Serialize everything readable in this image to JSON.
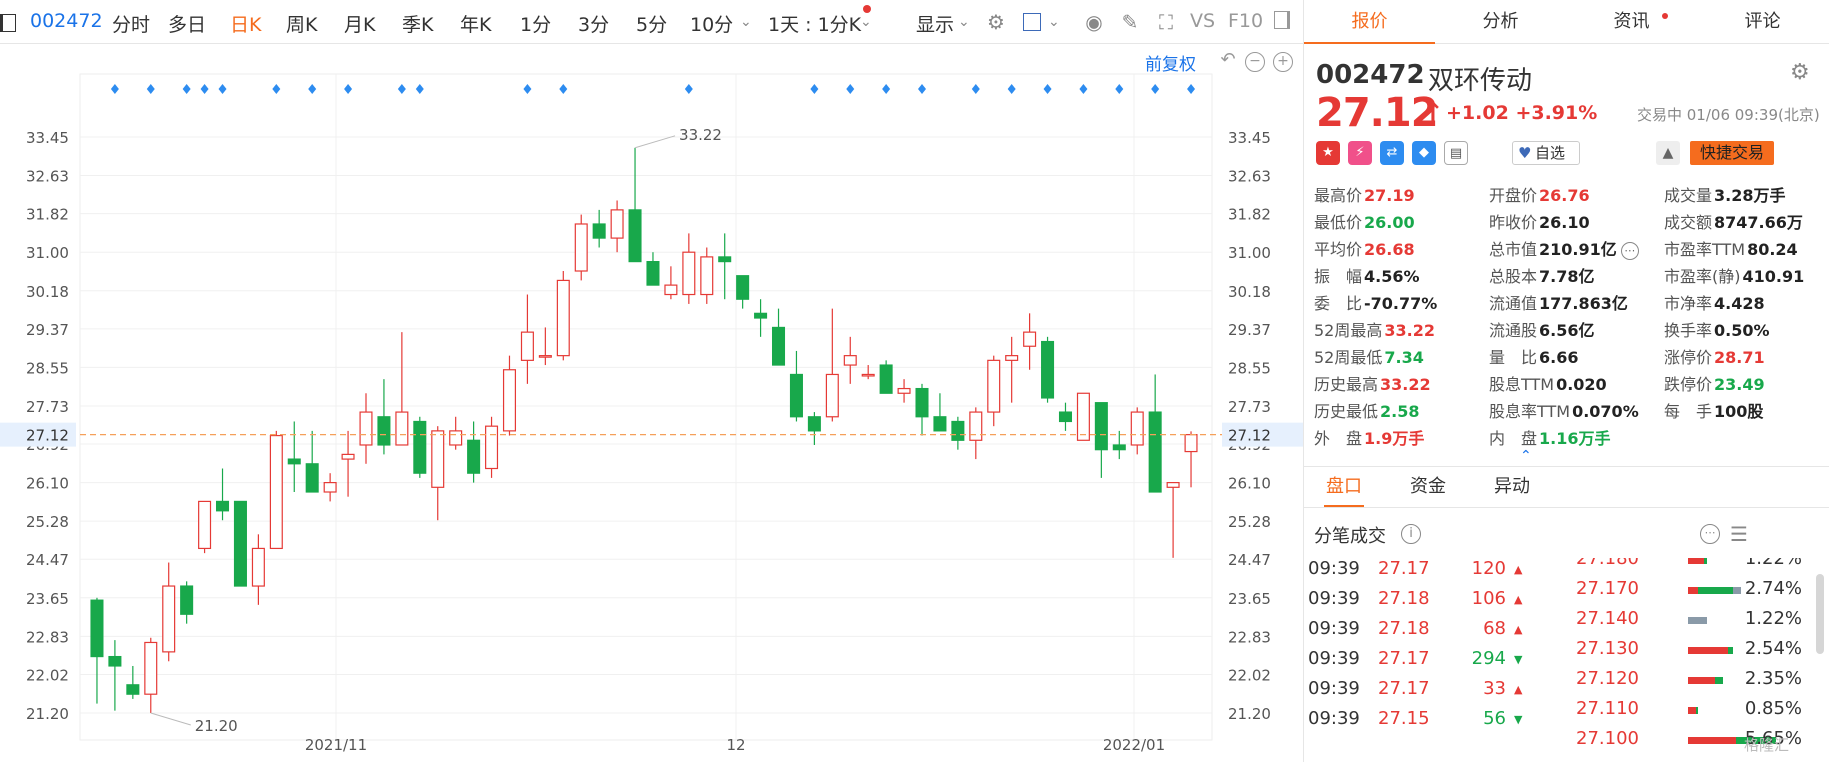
{
  "toolbar": {
    "code": "002472",
    "items": [
      "分时",
      "多日",
      "日K",
      "周K",
      "月K",
      "季K",
      "年K",
      "1分",
      "3分",
      "5分",
      "10分"
    ],
    "active": "日K",
    "period_select": "1天 : 1分K",
    "display_label": "显示",
    "vs_label": "VS",
    "f10_label": "F10"
  },
  "chart_controls": {
    "restore_label": "前复权"
  },
  "chart_data": {
    "type": "candlestick",
    "y_ticks": [
      "33.45",
      "32.63",
      "31.82",
      "31.00",
      "30.18",
      "29.37",
      "28.55",
      "27.73",
      "26.92",
      "26.10",
      "25.28",
      "24.47",
      "23.65",
      "22.83",
      "22.02",
      "21.20"
    ],
    "ylim": [
      21.2,
      33.45
    ],
    "x_labels": [
      "2021/11",
      "12",
      "2022/01"
    ],
    "current_price_label": "27.12",
    "max_label": "33.22",
    "min_label": "21.20",
    "candles": [
      {
        "o": 23.6,
        "h": 23.65,
        "l": 21.4,
        "c": 22.4
      },
      {
        "o": 22.4,
        "h": 22.75,
        "l": 21.25,
        "c": 22.2
      },
      {
        "o": 21.8,
        "h": 22.2,
        "l": 21.5,
        "c": 21.6
      },
      {
        "o": 21.6,
        "h": 22.8,
        "l": 21.2,
        "c": 22.7
      },
      {
        "o": 22.5,
        "h": 24.4,
        "l": 22.3,
        "c": 23.9
      },
      {
        "o": 23.9,
        "h": 24.0,
        "l": 23.1,
        "c": 23.3
      },
      {
        "o": 24.7,
        "h": 25.7,
        "l": 24.6,
        "c": 25.7
      },
      {
        "o": 25.7,
        "h": 26.4,
        "l": 25.3,
        "c": 25.5
      },
      {
        "o": 25.7,
        "h": 25.7,
        "l": 23.9,
        "c": 23.9
      },
      {
        "o": 23.9,
        "h": 25.0,
        "l": 23.5,
        "c": 24.7
      },
      {
        "o": 24.7,
        "h": 27.2,
        "l": 24.7,
        "c": 27.1
      },
      {
        "o": 26.6,
        "h": 27.4,
        "l": 25.9,
        "c": 26.5
      },
      {
        "o": 26.5,
        "h": 27.2,
        "l": 25.9,
        "c": 25.9
      },
      {
        "o": 25.9,
        "h": 26.3,
        "l": 25.7,
        "c": 26.1
      },
      {
        "o": 26.6,
        "h": 27.2,
        "l": 25.8,
        "c": 26.7
      },
      {
        "o": 26.9,
        "h": 28.0,
        "l": 26.5,
        "c": 27.6
      },
      {
        "o": 27.5,
        "h": 28.3,
        "l": 26.7,
        "c": 26.9
      },
      {
        "o": 26.9,
        "h": 29.3,
        "l": 26.9,
        "c": 27.6
      },
      {
        "o": 27.4,
        "h": 27.5,
        "l": 26.2,
        "c": 26.3
      },
      {
        "o": 26.0,
        "h": 27.3,
        "l": 25.3,
        "c": 27.2
      },
      {
        "o": 26.9,
        "h": 27.5,
        "l": 26.8,
        "c": 27.2
      },
      {
        "o": 27.0,
        "h": 27.4,
        "l": 26.1,
        "c": 26.3
      },
      {
        "o": 26.4,
        "h": 27.5,
        "l": 26.2,
        "c": 27.3
      },
      {
        "o": 27.2,
        "h": 28.8,
        "l": 27.1,
        "c": 28.5
      },
      {
        "o": 28.7,
        "h": 30.1,
        "l": 28.2,
        "c": 29.3
      },
      {
        "o": 28.8,
        "h": 29.4,
        "l": 28.6,
        "c": 28.8
      },
      {
        "o": 28.8,
        "h": 30.6,
        "l": 28.7,
        "c": 30.4
      },
      {
        "o": 30.6,
        "h": 31.8,
        "l": 30.4,
        "c": 31.6
      },
      {
        "o": 31.6,
        "h": 31.9,
        "l": 31.1,
        "c": 31.3
      },
      {
        "o": 31.3,
        "h": 32.1,
        "l": 31.0,
        "c": 31.9
      },
      {
        "o": 31.9,
        "h": 33.22,
        "l": 30.8,
        "c": 30.8
      },
      {
        "o": 30.8,
        "h": 31.0,
        "l": 30.3,
        "c": 30.3
      },
      {
        "o": 30.1,
        "h": 30.7,
        "l": 30.0,
        "c": 30.3
      },
      {
        "o": 30.1,
        "h": 31.4,
        "l": 29.9,
        "c": 31.0
      },
      {
        "o": 30.1,
        "h": 31.1,
        "l": 29.9,
        "c": 30.9
      },
      {
        "o": 30.9,
        "h": 31.4,
        "l": 30.0,
        "c": 30.8
      },
      {
        "o": 30.5,
        "h": 30.5,
        "l": 29.8,
        "c": 30.0
      },
      {
        "o": 29.7,
        "h": 30.0,
        "l": 29.2,
        "c": 29.6
      },
      {
        "o": 29.4,
        "h": 29.8,
        "l": 28.6,
        "c": 28.6
      },
      {
        "o": 28.4,
        "h": 28.9,
        "l": 27.4,
        "c": 27.5
      },
      {
        "o": 27.5,
        "h": 27.6,
        "l": 26.9,
        "c": 27.2
      },
      {
        "o": 27.5,
        "h": 29.8,
        "l": 27.4,
        "c": 28.4
      },
      {
        "o": 28.6,
        "h": 29.2,
        "l": 28.2,
        "c": 28.8
      },
      {
        "o": 28.4,
        "h": 28.6,
        "l": 28.3,
        "c": 28.4
      },
      {
        "o": 28.6,
        "h": 28.7,
        "l": 28.0,
        "c": 28.0
      },
      {
        "o": 28.0,
        "h": 28.3,
        "l": 27.8,
        "c": 28.1
      },
      {
        "o": 28.1,
        "h": 28.2,
        "l": 27.1,
        "c": 27.5
      },
      {
        "o": 27.5,
        "h": 28.0,
        "l": 27.2,
        "c": 27.2
      },
      {
        "o": 27.4,
        "h": 27.5,
        "l": 26.8,
        "c": 27.0
      },
      {
        "o": 27.0,
        "h": 27.7,
        "l": 26.6,
        "c": 27.6
      },
      {
        "o": 27.6,
        "h": 28.8,
        "l": 27.3,
        "c": 28.7
      },
      {
        "o": 28.7,
        "h": 29.2,
        "l": 27.8,
        "c": 28.8
      },
      {
        "o": 29.0,
        "h": 29.7,
        "l": 28.5,
        "c": 29.3
      },
      {
        "o": 29.1,
        "h": 29.2,
        "l": 27.8,
        "c": 27.9
      },
      {
        "o": 27.6,
        "h": 27.8,
        "l": 27.2,
        "c": 27.4
      },
      {
        "o": 27.0,
        "h": 28.0,
        "l": 27.0,
        "c": 28.0
      },
      {
        "o": 27.8,
        "h": 27.8,
        "l": 26.2,
        "c": 26.8
      },
      {
        "o": 26.9,
        "h": 27.2,
        "l": 26.6,
        "c": 26.8
      },
      {
        "o": 26.9,
        "h": 27.7,
        "l": 26.7,
        "c": 27.6
      },
      {
        "o": 27.6,
        "h": 28.4,
        "l": 25.9,
        "c": 25.9
      },
      {
        "o": 26.0,
        "h": 26.1,
        "l": 24.5,
        "c": 26.1
      },
      {
        "o": 26.76,
        "h": 27.19,
        "l": 26.0,
        "c": 27.12
      }
    ]
  },
  "panel": {
    "tabs": [
      "报价",
      "分析",
      "资讯",
      "评论"
    ],
    "active_tab": "报价",
    "code": "002472",
    "name": "双环传动",
    "price": "27.12",
    "change": "+1.02",
    "change_pct": "+3.91%",
    "trade_time": "交易中 01/06 09:39(北京)",
    "zixuan_label": "自选",
    "quick_trade_label": "快捷交易",
    "stats": [
      [
        {
          "l": "最高价",
          "v": "27.19",
          "c": "up"
        },
        {
          "l": "开盘价",
          "v": "26.76",
          "c": "up"
        },
        {
          "l": "成交量",
          "v": "3.28万手",
          "c": ""
        }
      ],
      [
        {
          "l": "最低价",
          "v": "26.00",
          "c": "down"
        },
        {
          "l": "昨收价",
          "v": "26.10",
          "c": ""
        },
        {
          "l": "成交额",
          "v": "8747.66万",
          "c": ""
        }
      ],
      [
        {
          "l": "平均价",
          "v": "26.68",
          "c": "up"
        },
        {
          "l": "总市值",
          "v": "210.91亿",
          "c": ""
        },
        {
          "l": "市盈率TTM",
          "v": "80.24",
          "c": ""
        }
      ],
      [
        {
          "l": "振　幅",
          "v": "4.56%",
          "c": ""
        },
        {
          "l": "总股本",
          "v": "7.78亿",
          "c": ""
        },
        {
          "l": "市盈率(静)",
          "v": "410.91",
          "c": ""
        }
      ],
      [
        {
          "l": "委　比",
          "v": "-70.77%",
          "c": ""
        },
        {
          "l": "流通值",
          "v": "177.863亿",
          "c": ""
        },
        {
          "l": "市净率",
          "v": "4.428",
          "c": ""
        }
      ],
      [
        {
          "l": "52周最高",
          "v": "33.22",
          "c": "up"
        },
        {
          "l": "流通股",
          "v": "6.56亿",
          "c": ""
        },
        {
          "l": "换手率",
          "v": "0.50%",
          "c": ""
        }
      ],
      [
        {
          "l": "52周最低",
          "v": "7.34",
          "c": "down"
        },
        {
          "l": "量　比",
          "v": "6.66",
          "c": ""
        },
        {
          "l": "涨停价",
          "v": "28.71",
          "c": "up"
        }
      ],
      [
        {
          "l": "历史最高",
          "v": "33.22",
          "c": "up"
        },
        {
          "l": "股息TTM",
          "v": "0.020",
          "c": ""
        },
        {
          "l": "跌停价",
          "v": "23.49",
          "c": "down"
        }
      ],
      [
        {
          "l": "历史最低",
          "v": "2.58",
          "c": "down"
        },
        {
          "l": "股息率TTM",
          "v": "0.070%",
          "c": ""
        },
        {
          "l": "每　手",
          "v": "100股",
          "c": ""
        }
      ],
      [
        {
          "l": "外　盘",
          "v": "1.9万手",
          "c": "up"
        },
        {
          "l": "内　盘",
          "v": "1.16万手",
          "c": "down"
        }
      ]
    ],
    "subtabs": [
      "盘口",
      "资金",
      "异动"
    ],
    "active_subtab": "盘口",
    "tick_title": "分笔成交",
    "ticks": [
      {
        "t": "09:39",
        "p": "27.17",
        "v": "120",
        "d": "up"
      },
      {
        "t": "09:39",
        "p": "27.18",
        "v": "106",
        "d": "up"
      },
      {
        "t": "09:39",
        "p": "27.18",
        "v": "68",
        "d": "up"
      },
      {
        "t": "09:39",
        "p": "27.17",
        "v": "294",
        "d": "down"
      },
      {
        "t": "09:39",
        "p": "27.17",
        "v": "33",
        "d": "up"
      },
      {
        "t": "09:39",
        "p": "27.15",
        "v": "56",
        "d": "down"
      }
    ],
    "dist": [
      {
        "p": "27.180",
        "pct": "1.22%",
        "r": 0.1,
        "g": 0.02,
        "x": 0.0
      },
      {
        "p": "27.170",
        "pct": "2.74%",
        "r": 0.06,
        "g": 0.22,
        "x": 0.05
      },
      {
        "p": "27.140",
        "pct": "1.22%",
        "r": 0.0,
        "g": 0.0,
        "x": 0.12
      },
      {
        "p": "27.130",
        "pct": "2.54%",
        "r": 0.25,
        "g": 0.03,
        "x": 0.0
      },
      {
        "p": "27.120",
        "pct": "2.35%",
        "r": 0.17,
        "g": 0.05,
        "x": 0.0
      },
      {
        "p": "27.110",
        "pct": "0.85%",
        "r": 0.05,
        "g": 0.01,
        "x": 0.0
      },
      {
        "p": "27.100",
        "pct": "5.65%",
        "r": 0.3,
        "g": 0.25,
        "x": 0.0
      }
    ]
  },
  "watermark": "格隆汇",
  "colors": {
    "up": "#e53935",
    "down": "#18a84b",
    "accent": "#f56c1e",
    "link": "#1a73e8",
    "dash": "#f5a05a"
  }
}
